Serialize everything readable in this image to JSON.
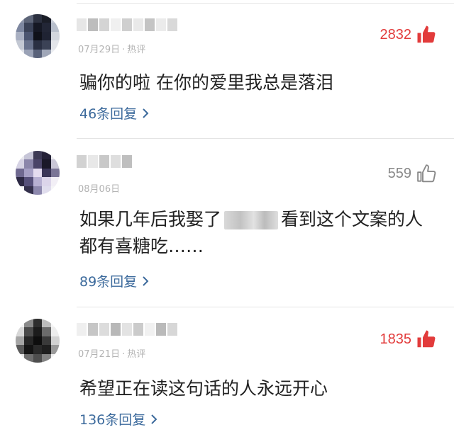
{
  "colors": {
    "hot_like": "#e23b3b",
    "normal_like": "#888888",
    "reply_link": "#3c6a9c",
    "meta_text": "#b3b3b3"
  },
  "comments": [
    {
      "date": "07月29日",
      "dot": "·",
      "hot_tag": "热评",
      "likes": "2832",
      "liked_icon": "thumbs-up-filled-icon",
      "text": "骗你的啦 在你的爱里我总是落泪",
      "replies": "46条回复"
    },
    {
      "date": "08月06日",
      "likes": "559",
      "liked_icon": "thumbs-up-outline-icon",
      "text_before": "如果几年后我娶了",
      "text_after": "看到这个文案的人都有喜糖吃……",
      "replies": "89条回复"
    },
    {
      "date": "07月21日",
      "dot": "·",
      "hot_tag": "热评",
      "likes": "1835",
      "liked_icon": "thumbs-up-filled-icon",
      "text": "希望正在读这句话的人永远开心",
      "replies": "136条回复"
    }
  ]
}
